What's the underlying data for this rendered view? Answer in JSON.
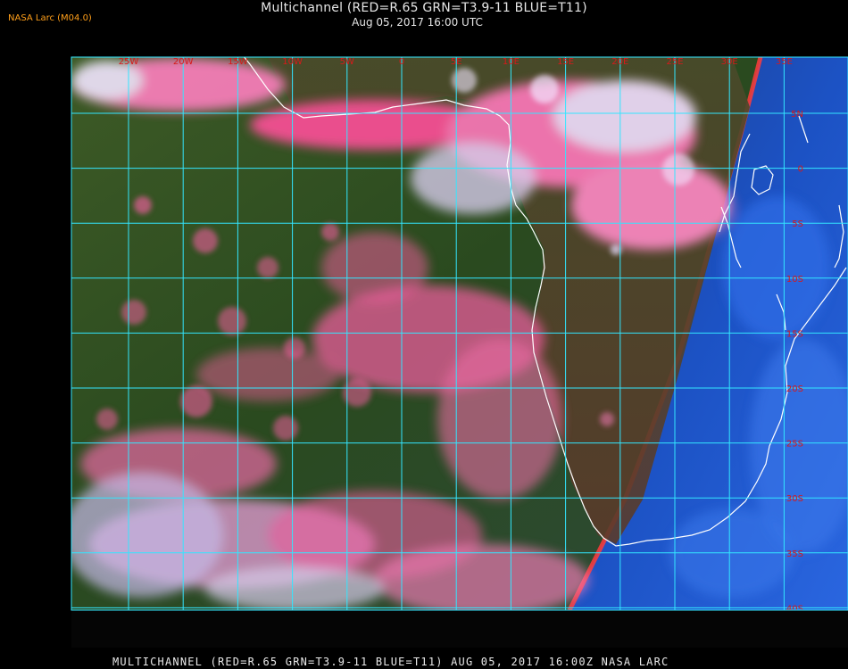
{
  "header": {
    "brand": "NASA Larc (M04.0)",
    "title": "Multichannel (RED=R.65 GRN=T3.9-11 BLUE=T11)",
    "subtitle": "Aug 05, 2017 16:00 UTC"
  },
  "footer": {
    "caption": "MULTICHANNEL (RED=R.65 GRN=T3.9-11 BLUE=T11) AUG 05, 2017 16:00Z   NASA LARC"
  },
  "map": {
    "lon_labels": [
      "25W",
      "20W",
      "15W",
      "10W",
      "5W",
      "0",
      "5E",
      "10E",
      "15E",
      "20E",
      "25E",
      "30E",
      "35E"
    ],
    "lat_labels": [
      "5N",
      "0",
      "5S",
      "10S",
      "15S",
      "20S",
      "25S",
      "30S",
      "35S",
      "40S"
    ],
    "colors": {
      "grid": "#33e6ff",
      "labels": "#d8191a",
      "coastline": "#ffffff",
      "ocean_green": "#2e4a1c",
      "cloud_pink": "#ff5fa8",
      "cloud_white": "#f2e6ff",
      "night_blue": "#1d55c8"
    }
  }
}
